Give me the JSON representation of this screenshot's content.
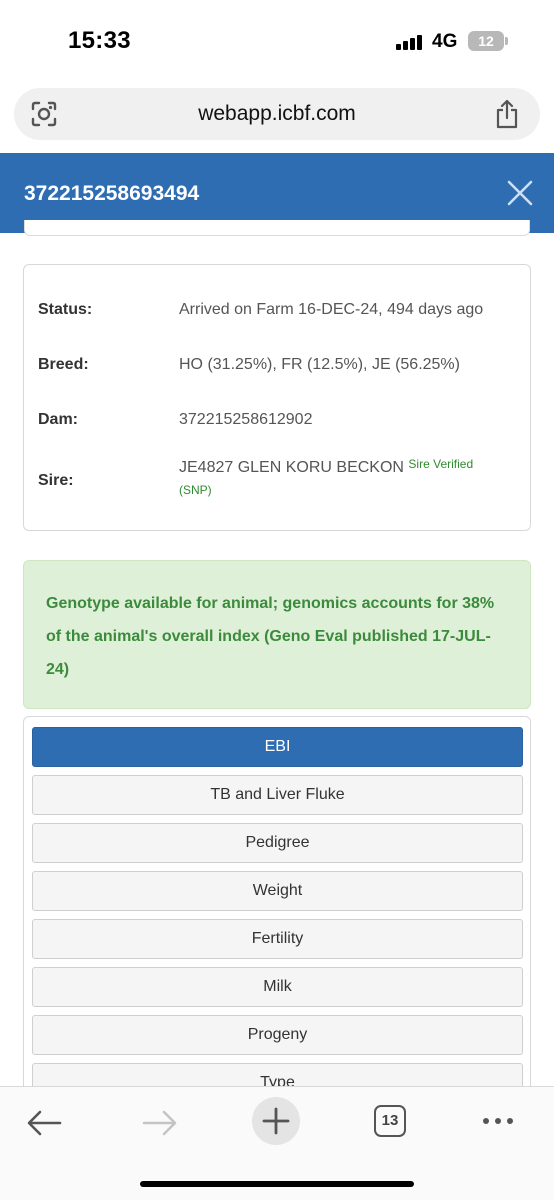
{
  "status_bar": {
    "time": "15:33",
    "network": "4G",
    "battery": "12"
  },
  "browser": {
    "url": "webapp.icbf.com",
    "lens_icon": "camera-search-icon",
    "share_icon": "share-icon"
  },
  "modal": {
    "title": "372215258693494",
    "close_icon": "close-icon"
  },
  "animal_info": {
    "status_label": "Status:",
    "status_value": "Arrived on Farm 16-DEC-24, 494 days ago",
    "breed_label": "Breed:",
    "breed_value": "HO (31.25%), FR (12.5%), JE (56.25%)",
    "dam_label": "Dam:",
    "dam_value": "372215258612902",
    "sire_label": "Sire:",
    "sire_value": "JE4827 GLEN KORU BECKON",
    "sire_verified": "Sire Verified",
    "sire_verified_method": "(SNP)"
  },
  "genotype_notice": {
    "text": "Genotype available for animal; genomics accounts for 38% of the animal's overall index (Geno Eval published 17-JUL-24)"
  },
  "tabs": [
    {
      "label": "EBI",
      "active": true
    },
    {
      "label": "TB and Liver Fluke",
      "active": false
    },
    {
      "label": "Pedigree",
      "active": false
    },
    {
      "label": "Weight",
      "active": false
    },
    {
      "label": "Fertility",
      "active": false
    },
    {
      "label": "Milk",
      "active": false
    },
    {
      "label": "Progeny",
      "active": false
    },
    {
      "label": "Type",
      "active": false
    }
  ],
  "toolbar": {
    "back_icon": "back-arrow-icon",
    "forward_icon": "forward-arrow-icon",
    "new_tab_icon": "plus-icon",
    "tab_count": "13",
    "more_icon": "more-dots-icon"
  },
  "colors": {
    "header_blue": "#2f6db2",
    "notice_green_bg": "#dff0d8",
    "notice_green_text": "#3c8a3c",
    "verified_green": "#2e8b2e"
  }
}
